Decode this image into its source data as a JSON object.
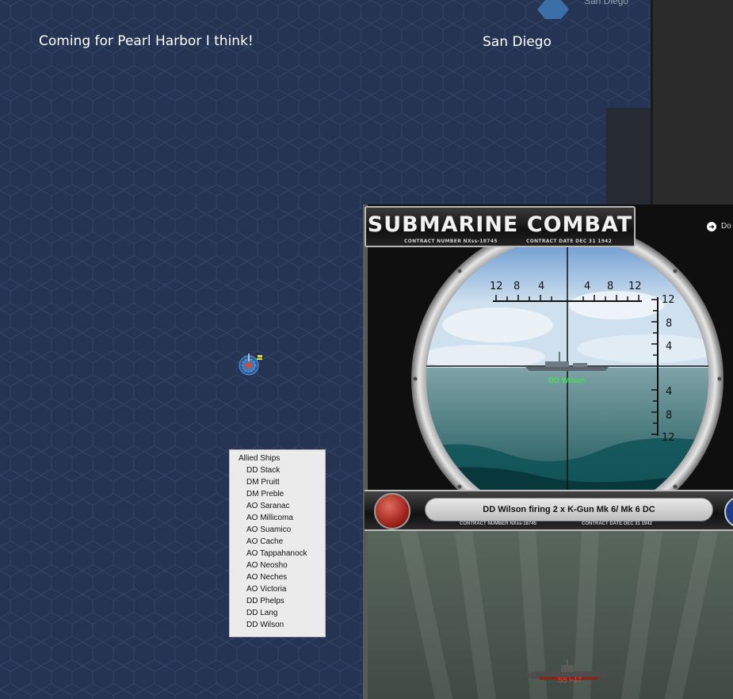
{
  "map": {
    "note_label": "Coming for Pearl Harbor I think!",
    "city_label": "San Diego",
    "top_city_label": "San Diego",
    "colors": {
      "ocean": "#243452",
      "hex_line": "#34466a"
    },
    "task_force_icon": "task-force-icon"
  },
  "ship_list": {
    "header": "Allied Ships",
    "ships": [
      "DD Stack",
      "DM Pruitt",
      "DM Preble",
      "AO Saranac",
      "AO Millicoma",
      "AO Suamico",
      "AO Cache",
      "AO Tappahanock",
      "AO Neosho",
      "AO Neches",
      "AO Victoria",
      "DD Phelps",
      "DD Lang",
      "DD Wilson"
    ]
  },
  "combat": {
    "title": "SUBMARINE COMBAT",
    "contract_number": "CONTRACT NUMBER  NXss-18745",
    "contract_date": "CONTRACT DATE  DEC 31 1942",
    "done_label": "Do",
    "target_ship_label": "DD Wilson",
    "scope_ticks_top": [
      "12",
      "8",
      "4",
      "4",
      "8",
      "12"
    ],
    "scope_ticks_right": [
      "12",
      "8",
      "4",
      "4",
      "8",
      "12"
    ],
    "message": "DD Wilson firing 2 x K-Gun Mk 6/ Mk 6 DC",
    "status_contract_number": "CONTRACT NUMBER  NXss-18745",
    "status_contract_date": "CONTRACT DATE  DEC 31 1942",
    "submarine_label": "SS I-17",
    "colors": {
      "target_label": "#33ff33",
      "sub_label": "#ff3b3b"
    }
  }
}
